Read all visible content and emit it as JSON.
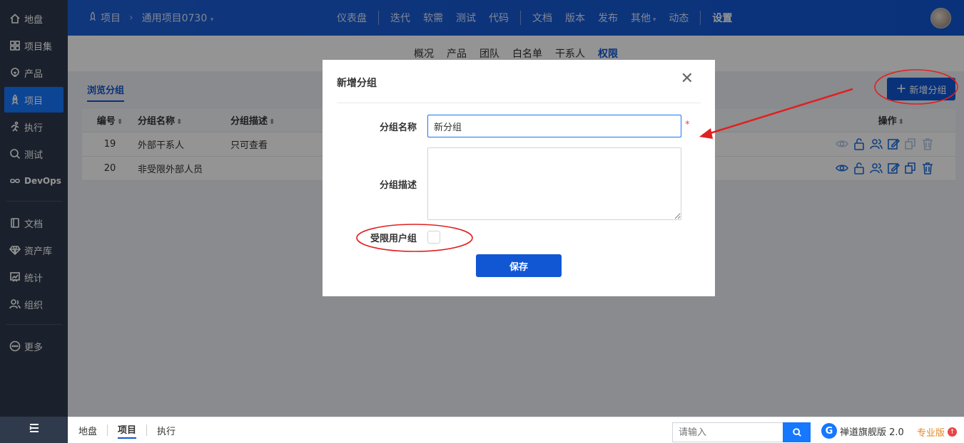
{
  "sidebar": {
    "items": [
      {
        "label": "地盘",
        "icon": "home-icon"
      },
      {
        "label": "项目集",
        "icon": "grid-icon"
      },
      {
        "label": "产品",
        "icon": "bulb-icon"
      },
      {
        "label": "项目",
        "icon": "rocket-icon",
        "active": true
      },
      {
        "label": "执行",
        "icon": "run-icon"
      },
      {
        "label": "测试",
        "icon": "search-icon"
      },
      {
        "label": "DevOps",
        "icon": "infinity-icon"
      },
      {
        "label": "文档",
        "icon": "book-icon"
      },
      {
        "label": "资产库",
        "icon": "diamond-icon"
      },
      {
        "label": "统计",
        "icon": "chart-icon"
      },
      {
        "label": "组织",
        "icon": "users-icon"
      },
      {
        "label": "更多",
        "icon": "more-icon"
      }
    ]
  },
  "header": {
    "crumb_root": "项目",
    "crumb_project": "通用项目0730",
    "nav": [
      "仪表盘",
      "迭代",
      "软需",
      "测试",
      "代码",
      "文档",
      "版本",
      "发布",
      "其他",
      "动态",
      "设置"
    ]
  },
  "subnav": {
    "items": [
      "概况",
      "产品",
      "团队",
      "白名单",
      "干系人",
      "权限"
    ],
    "active": "权限"
  },
  "panel": {
    "tab": "浏览分组",
    "add_button": "新增分组"
  },
  "table": {
    "headers": {
      "id": "编号",
      "name": "分组名称",
      "desc": "分组描述",
      "op": "操作"
    },
    "rows": [
      {
        "id": "19",
        "name": "外部干系人",
        "desc": "只可查看"
      },
      {
        "id": "20",
        "name": "非受限外部人员",
        "desc": ""
      }
    ]
  },
  "modal": {
    "title": "新增分组",
    "name_label": "分组名称",
    "name_value": "新分组",
    "required_mark": "*",
    "desc_label": "分组描述",
    "limited_label": "受限用户组",
    "save": "保存"
  },
  "footer": {
    "crumbs": [
      "地盘",
      "项目",
      "执行"
    ],
    "search_placeholder": "请输入",
    "brand": "禅道旗舰版 2.0",
    "edition": "专业版"
  },
  "colors": {
    "primary": "#1157d4",
    "sidebar": "#2f3a4c",
    "annotation": "#e02020"
  }
}
